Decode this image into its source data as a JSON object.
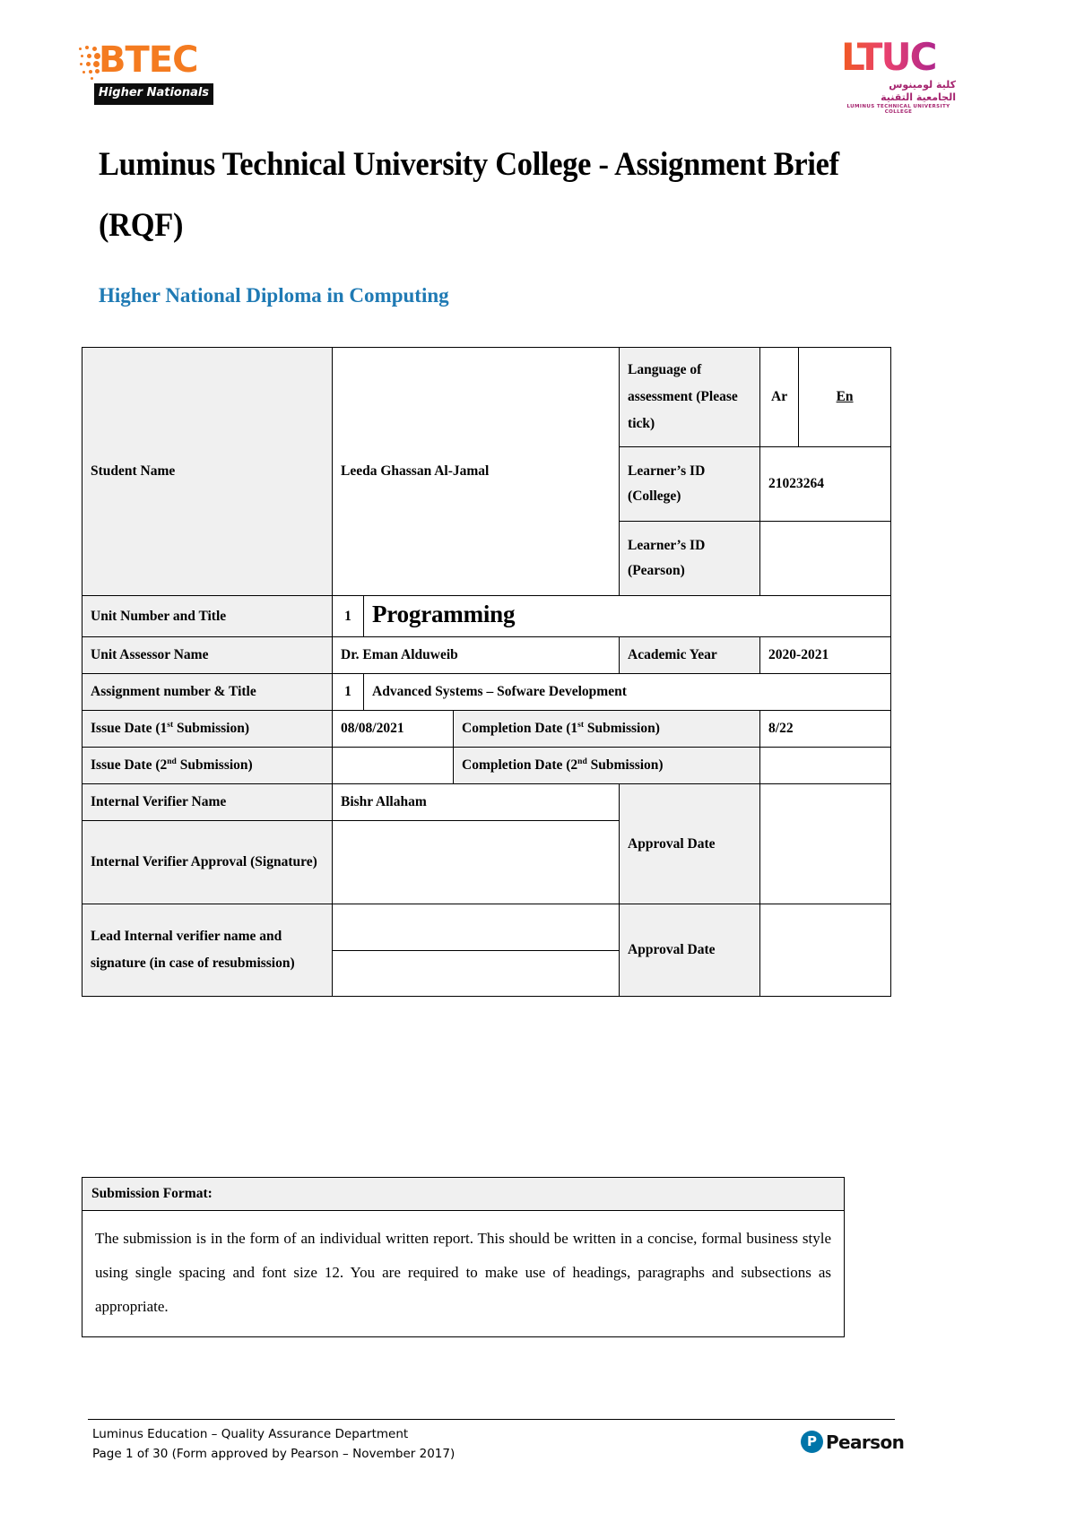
{
  "logos": {
    "btec": {
      "word": "BTEC",
      "band": "Higher Nationals"
    },
    "ltuc": {
      "word": "LTUC",
      "arabic_line1": "كلية لومينوس",
      "arabic_line2": "الجامعية التقنية",
      "english_line": "LUMINUS TECHNICAL UNIVERSITY COLLEGE"
    },
    "pearson": {
      "word": "Pearson",
      "mark": "p-mark"
    }
  },
  "header": {
    "title": "Luminus Technical University College - Assignment Brief (RQF)",
    "subtitle": "Higher National Diploma in Computing",
    "subtitle_color": "#1f7ab4"
  },
  "brief_table": {
    "student_name_label": "Student Name",
    "student_name_value": "Leeda Ghassan Al-Jamal",
    "language_label": "Language of assessment (Please tick)",
    "language_option_ar": "Ar",
    "language_option_en": "En",
    "language_selected": "En",
    "learner_id_college_label": "Learner’s ID (College)",
    "learner_id_college_value": "21023264",
    "learner_id_pearson_label": "Learner’s ID (Pearson)",
    "learner_id_pearson_value": "",
    "unit_number_label": "Unit Number and Title",
    "unit_number_value": "1",
    "unit_title_value": "Programming",
    "unit_assessor_label": "Unit Assessor Name",
    "unit_assessor_value": "Dr. Eman Alduweib",
    "academic_year_label": "Academic Year",
    "academic_year_value": "2020-2021",
    "assignment_number_label": "Assignment number & Title",
    "assignment_number_value": "1",
    "assignment_title_value": "Advanced Systems – Sofware Development",
    "issue_date_1_label_pre": "Issue Date (1",
    "issue_date_1_label_sup": "st",
    "issue_date_1_label_post": " Submission)",
    "issue_date_1_value": "08/08/2021",
    "completion_date_1_label_pre": "Completion Date (1",
    "completion_date_1_label_sup": "st",
    "completion_date_1_label_post": " Submission)",
    "completion_date_1_value": "8/22",
    "issue_date_2_label_pre": "Issue Date (2",
    "issue_date_2_label_sup": "nd",
    "issue_date_2_label_post": " Submission)",
    "issue_date_2_value": "",
    "completion_date_2_label_pre": "Completion Date (2",
    "completion_date_2_label_sup": "nd",
    "completion_date_2_label_post": " Submission)",
    "completion_date_2_value": "",
    "internal_verifier_name_label": "Internal Verifier Name",
    "internal_verifier_name_value": "Bishr Allaham",
    "internal_verifier_approval_label": "Internal Verifier Approval (Signature)",
    "internal_verifier_approval_value": "",
    "approval_date_label_1": "Approval Date",
    "approval_date_value_1": "",
    "lead_verifier_label_bold": "Lead Internal verifier name and signature ",
    "lead_verifier_label_normal": "(in case of resubmission)",
    "lead_verifier_value": "",
    "approval_date_label_2": "Approval Date",
    "approval_date_value_2": ""
  },
  "submission_format": {
    "heading": "Submission Format:",
    "body": "The submission is in the form of an individual written report. This should be written in a concise, formal business style using single spacing and font size 12. You are required to make use of headings, paragraphs and subsections as appropriate."
  },
  "footer": {
    "line1": "Luminus Education – Quality Assurance Department",
    "line2": "Page 1 of 30 (Form approved by Pearson – November 2017)"
  }
}
